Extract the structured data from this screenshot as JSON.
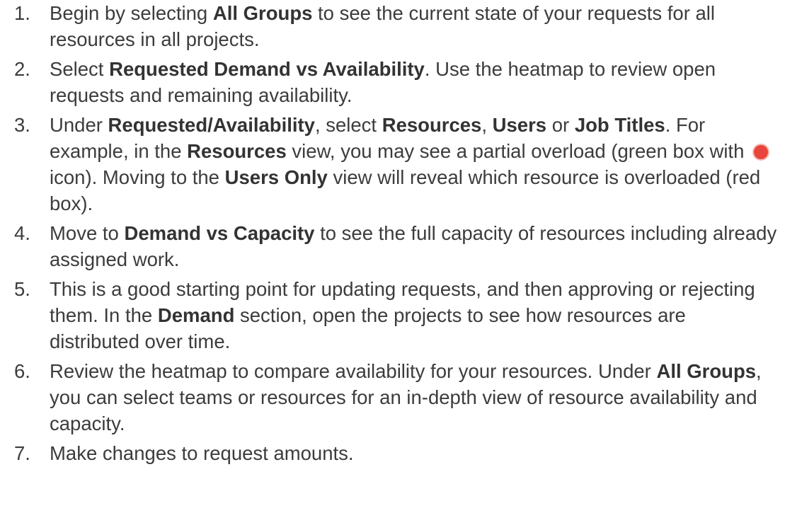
{
  "steps": [
    {
      "number": "1.",
      "segments": [
        {
          "t": "Begin by selecting "
        },
        {
          "t": "All Groups",
          "b": true
        },
        {
          "t": " to see the current state of your requests for all resources in all projects."
        }
      ]
    },
    {
      "number": "2.",
      "segments": [
        {
          "t": "Select "
        },
        {
          "t": "Requested Demand vs Availability",
          "b": true
        },
        {
          "t": ". Use the heatmap to review open requests and remaining availability."
        }
      ]
    },
    {
      "number": "3.",
      "segments": [
        {
          "t": "Under "
        },
        {
          "t": "Requested/Availability",
          "b": true
        },
        {
          "t": ", select "
        },
        {
          "t": "Resources",
          "b": true
        },
        {
          "t": ", "
        },
        {
          "t": "Users",
          "b": true
        },
        {
          "t": " or "
        },
        {
          "t": "Job Titles",
          "b": true
        },
        {
          "t": ". For example, in the "
        },
        {
          "t": "Resources",
          "b": true
        },
        {
          "t": " view, you may see a partial overload (green box with "
        },
        {
          "icon": "overload-dot-icon"
        },
        {
          "t": " icon). Moving to the "
        },
        {
          "t": "Users Only",
          "b": true
        },
        {
          "t": " view will reveal which resource is overloaded (red box)."
        }
      ]
    },
    {
      "number": "4.",
      "segments": [
        {
          "t": "Move to "
        },
        {
          "t": "Demand vs Capacity",
          "b": true
        },
        {
          "t": " to see the full capacity of resources including already assigned work."
        }
      ]
    },
    {
      "number": "5.",
      "segments": [
        {
          "t": "This is a good starting point for updating requests, and then approving or rejecting them. In the "
        },
        {
          "t": "Demand",
          "b": true
        },
        {
          "t": " section, open the projects to see how resources are distributed over time."
        }
      ]
    },
    {
      "number": "6.",
      "segments": [
        {
          "t": "Review the heatmap to compare availability for your resources. Under "
        },
        {
          "t": "All Groups",
          "b": true
        },
        {
          "t": ", you can select teams or resources for an in-depth view of resource availability and capacity."
        }
      ]
    },
    {
      "number": "7.",
      "segments": [
        {
          "t": "Make changes to request amounts."
        }
      ]
    }
  ],
  "colors": {
    "text": "#3c3c3c",
    "overload_dot": "#e8453c"
  }
}
